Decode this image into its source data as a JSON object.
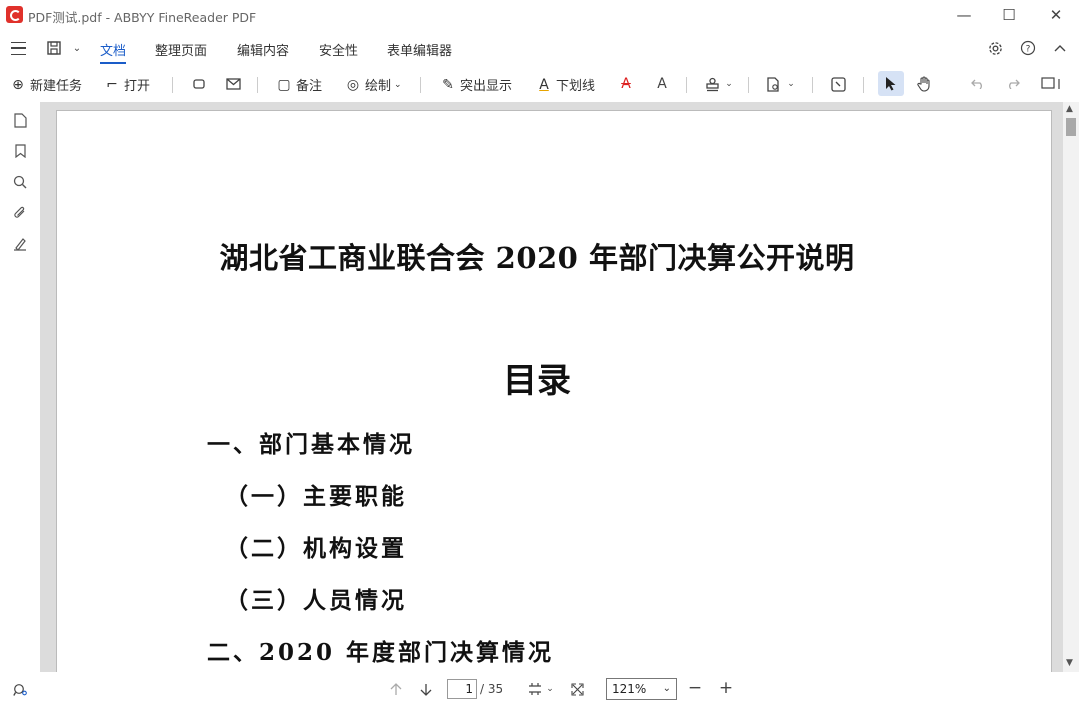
{
  "window": {
    "title": "PDF测试.pdf - ABBYY FineReader PDF",
    "minimize": "—",
    "maximize": "☐",
    "close": "✕"
  },
  "menu": {
    "tabs": [
      "文档",
      "整理页面",
      "编辑内容",
      "安全性",
      "表单编辑器"
    ],
    "active_tab": "文档",
    "settings_icon": "gear-icon",
    "help_label": "?",
    "collapse_label": "^"
  },
  "toolbar": {
    "new_task": "新建任务",
    "open": "打开",
    "comment": "备注",
    "draw": "绘制",
    "highlight": "突出显示",
    "underline": "下划线",
    "underline_glyph": "A",
    "strike_glyph": "A",
    "text_glyph": "A"
  },
  "document": {
    "title": "湖北省工商业联合会 2020 年部门决算公开说明",
    "toc_heading": "目录",
    "toc_items": [
      "一、部门基本情况",
      "（一）主要职能",
      "（二）机构设置",
      "（三）人员情况",
      "二、2020 年度部门决算情况"
    ]
  },
  "status": {
    "current_page": "1",
    "total_pages": "/ 35",
    "zoom": "121%",
    "zoom_out": "−",
    "zoom_in": "+"
  },
  "colors": {
    "accent": "#1a5cc8",
    "app_icon": "#e0312b",
    "doc_background": "#dcdcdc"
  }
}
